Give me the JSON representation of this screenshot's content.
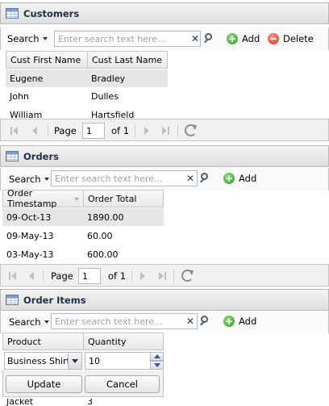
{
  "customers": {
    "title": "Customers",
    "search_label": "Search",
    "search_placeholder": "Enter search text here...",
    "add_label": "Add",
    "delete_label": "Delete",
    "columns": [
      "Cust First Name",
      "Cust Last Name"
    ],
    "rows": [
      [
        "Eugene",
        "Bradley"
      ],
      [
        "John",
        "Dulles"
      ],
      [
        "William",
        "Hartsfield"
      ]
    ],
    "pager": {
      "page_label": "Page",
      "page_value": "1",
      "of_label": "of 1"
    }
  },
  "orders": {
    "title": "Orders",
    "search_label": "Search",
    "search_placeholder": "Enter search text here...",
    "add_label": "Add",
    "columns": [
      "Order Timestamp",
      "Order Total"
    ],
    "rows": [
      [
        "09-Oct-13",
        "1890.00"
      ],
      [
        "09-May-13",
        "60.00"
      ],
      [
        "03-May-13",
        "600.00"
      ]
    ],
    "pager": {
      "page_label": "Page",
      "page_value": "1",
      "of_label": "of 1"
    }
  },
  "order_items": {
    "title": "Order Items",
    "search_label": "Search",
    "search_placeholder": "Enter search text here...",
    "add_label": "Add",
    "columns": [
      "Product",
      "Quantity"
    ],
    "editor": {
      "product": "Business Shirt",
      "quantity": "10"
    },
    "update_label": "Update",
    "cancel_label": "Cancel",
    "partial_row": [
      "Jacket",
      "3"
    ]
  },
  "icons": {
    "panel": "grid-icon",
    "clear": "clear-icon",
    "search": "magnifier-icon",
    "add": "add-icon",
    "delete": "delete-icon",
    "first": "first-page-icon",
    "prev": "prev-page-icon",
    "next": "next-page-icon",
    "last": "last-page-icon",
    "refresh": "refresh-icon"
  }
}
